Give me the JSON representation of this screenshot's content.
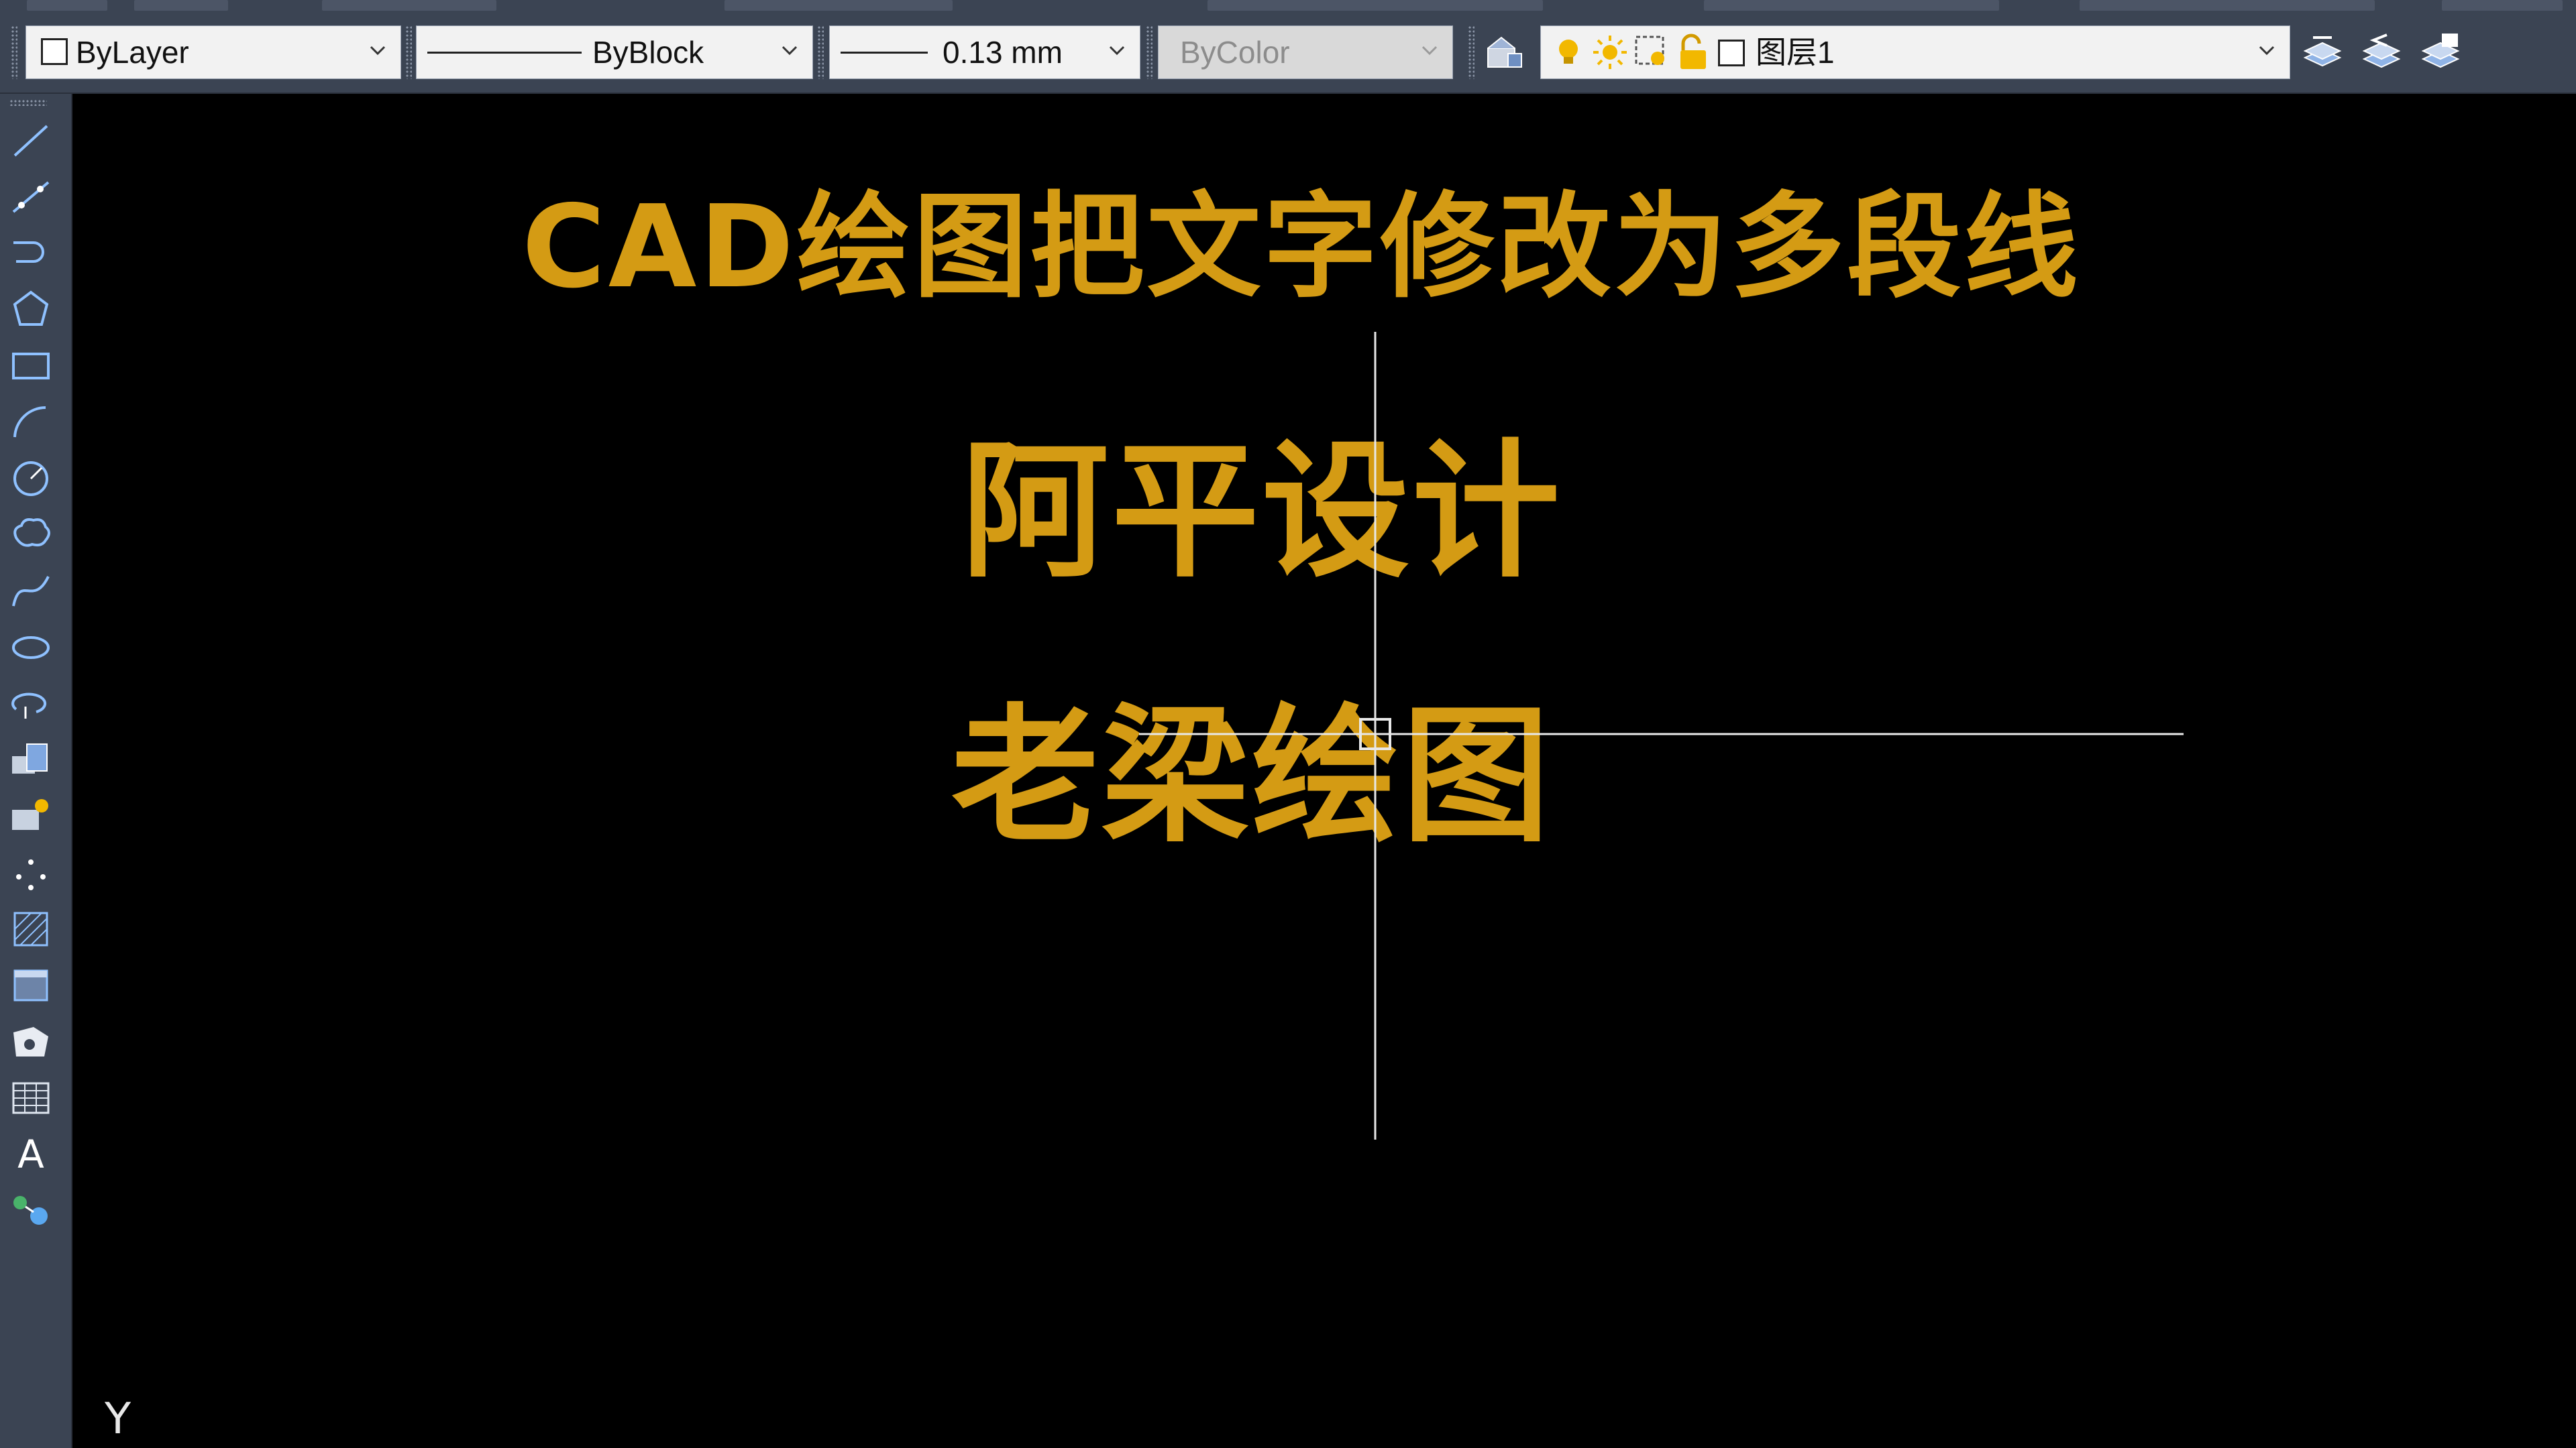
{
  "properties_toolbar": {
    "color_combo": {
      "value": "ByLayer"
    },
    "linetype_combo": {
      "value": "ByBlock"
    },
    "lineweight_combo": {
      "value": "0.13 mm"
    },
    "plotstyle_combo": {
      "value": "ByColor",
      "disabled": true
    },
    "layer_combo": {
      "value": "图层1"
    }
  },
  "draw_toolbar": {
    "tools": [
      {
        "name": "line-icon"
      },
      {
        "name": "construction-line-icon"
      },
      {
        "name": "polyline-icon"
      },
      {
        "name": "polygon-icon"
      },
      {
        "name": "rectangle-icon"
      },
      {
        "name": "arc-icon"
      },
      {
        "name": "circle-icon"
      },
      {
        "name": "revision-cloud-icon"
      },
      {
        "name": "spline-icon"
      },
      {
        "name": "ellipse-icon"
      },
      {
        "name": "ellipse-arc-icon"
      },
      {
        "name": "insert-block-icon"
      },
      {
        "name": "make-block-icon"
      },
      {
        "name": "point-icon"
      },
      {
        "name": "hatch-icon"
      },
      {
        "name": "gradient-icon"
      },
      {
        "name": "region-icon"
      },
      {
        "name": "table-icon"
      },
      {
        "name": "multiline-text-icon"
      },
      {
        "name": "add-selected-icon"
      }
    ],
    "text_tool_glyph": "A"
  },
  "canvas": {
    "title": "CAD绘图把文字修改为多段线",
    "line1": "阿平设计",
    "line2": "老梁绘图",
    "ucs_axis_label": "Y"
  },
  "colors": {
    "text_accent": "#d49b14",
    "toolbar_bg": "#3b4453",
    "canvas_bg": "#000000",
    "crosshair": "#e8e8e8"
  }
}
